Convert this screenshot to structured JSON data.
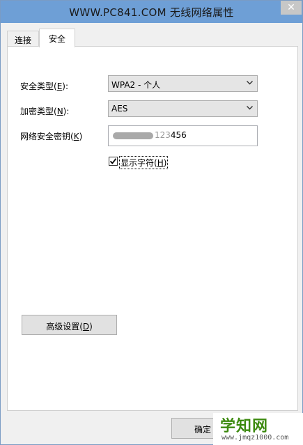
{
  "window": {
    "title": "WWW.PC841.COM 无线网络属性",
    "close_icon": "close-icon"
  },
  "tabs": [
    {
      "label": "连接",
      "active": false
    },
    {
      "label": "安全",
      "active": true
    }
  ],
  "security": {
    "type_label": "安全类型(",
    "type_key": "E",
    "type_suffix": "):",
    "type_value": "WPA2 - 个人",
    "encryption_label": "加密类型(",
    "encryption_key": "N",
    "encryption_suffix": "):",
    "encryption_value": "AES",
    "key_label": "网络安全密钥(",
    "key_key": "K",
    "key_suffix": ")",
    "key_visible_part": "456",
    "key_hidden_part": "123",
    "show_chars_label": "显示字符(",
    "show_chars_key": "H",
    "show_chars_suffix": ")",
    "show_chars_checked": true
  },
  "advanced_button": {
    "label": "高级设置(",
    "key": "D",
    "suffix": ")"
  },
  "ok_button": {
    "label": "确定"
  },
  "watermark": {
    "brand": "学知网",
    "url": "www.jmqz1000.com"
  },
  "colors": {
    "titlebar": "#6e9fd6",
    "panel": "#ffffff",
    "dialog": "#f0f0f0"
  }
}
